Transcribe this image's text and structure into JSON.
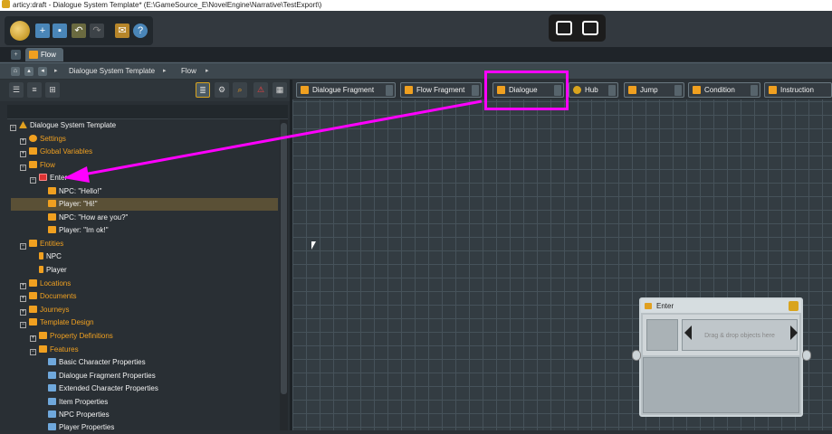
{
  "window": {
    "title": "articy:draft - Dialogue System Template* (E:\\GameSource_E\\NovelEngine\\Narrative\\TestExport\\)"
  },
  "main_toolbar": {
    "buttons": [
      {
        "name": "new-icon",
        "glyph": "+"
      },
      {
        "name": "save-icon",
        "glyph": "▪"
      },
      {
        "name": "undo-icon",
        "glyph": "↶"
      },
      {
        "name": "redo-icon",
        "glyph": "↷"
      },
      {
        "name": "mail-icon",
        "glyph": "✉"
      },
      {
        "name": "help-icon",
        "glyph": "?"
      }
    ]
  },
  "tabs": [
    {
      "label": "Flow"
    }
  ],
  "breadcrumb": {
    "items": [
      "Dialogue System Template",
      "Flow"
    ]
  },
  "palette": {
    "items": [
      {
        "label": "Dialogue Fragment"
      },
      {
        "label": "Flow Fragment"
      },
      {
        "label": "Dialogue"
      },
      {
        "label": "Hub"
      },
      {
        "label": "Jump"
      },
      {
        "label": "Condition"
      },
      {
        "label": "Instruction"
      }
    ]
  },
  "tree": {
    "nodes": [
      {
        "label": "Dialogue System Template",
        "level": 0,
        "icon": "project-icon",
        "color": "white"
      },
      {
        "label": "Settings",
        "level": 1,
        "icon": "gear-icon",
        "color": "orange"
      },
      {
        "label": "Global Variables",
        "level": 1,
        "icon": "variables-icon",
        "color": "orange"
      },
      {
        "label": "Flow",
        "level": 1,
        "icon": "folder-icon",
        "color": "orange"
      },
      {
        "label": "Enter",
        "level": 2,
        "icon": "dialogue-icon",
        "color": "white"
      },
      {
        "label": "NPC: \"Hello!\"",
        "level": 3,
        "icon": "speech-bubble-icon",
        "color": "white"
      },
      {
        "label": "Player: \"Hi!\"",
        "level": 3,
        "icon": "speech-bubble-icon",
        "color": "white"
      },
      {
        "label": "NPC: \"How are you?\"",
        "level": 3,
        "icon": "speech-bubble-icon",
        "color": "white"
      },
      {
        "label": "Player: \"Im ok!\"",
        "level": 3,
        "icon": "speech-bubble-icon",
        "color": "white"
      },
      {
        "label": "Entities",
        "level": 1,
        "icon": "folder-icon",
        "color": "orange"
      },
      {
        "label": "NPC",
        "level": 2,
        "icon": "entity-icon",
        "color": "white"
      },
      {
        "label": "Player",
        "level": 2,
        "icon": "entity-icon",
        "color": "white"
      },
      {
        "label": "Locations",
        "level": 1,
        "icon": "folder-icon",
        "color": "orange"
      },
      {
        "label": "Documents",
        "level": 1,
        "icon": "folder-icon",
        "color": "orange"
      },
      {
        "label": "Journeys",
        "level": 1,
        "icon": "folder-icon",
        "color": "orange"
      },
      {
        "label": "Template Design",
        "level": 1,
        "icon": "folder-icon",
        "color": "orange"
      },
      {
        "label": "Property Definitions",
        "level": 2,
        "icon": "folder-icon",
        "color": "orange"
      },
      {
        "label": "Features",
        "level": 2,
        "icon": "folder-icon",
        "color": "orange"
      },
      {
        "label": "Basic Character Properties",
        "level": 3,
        "icon": "feature-icon",
        "color": "white"
      },
      {
        "label": "Dialogue Fragment Properties",
        "level": 3,
        "icon": "feature-icon",
        "color": "white"
      },
      {
        "label": "Extended Character Properties",
        "level": 3,
        "icon": "feature-icon",
        "color": "white"
      },
      {
        "label": "Item Properties",
        "level": 3,
        "icon": "feature-icon",
        "color": "white"
      },
      {
        "label": "NPC Properties",
        "level": 3,
        "icon": "feature-icon",
        "color": "white"
      },
      {
        "label": "Player Properties",
        "level": 3,
        "icon": "feature-icon",
        "color": "white"
      }
    ]
  },
  "node": {
    "title": "Enter",
    "placeholder": "Drag & drop objects here"
  },
  "annotation": {
    "color": "#ff00ff"
  }
}
